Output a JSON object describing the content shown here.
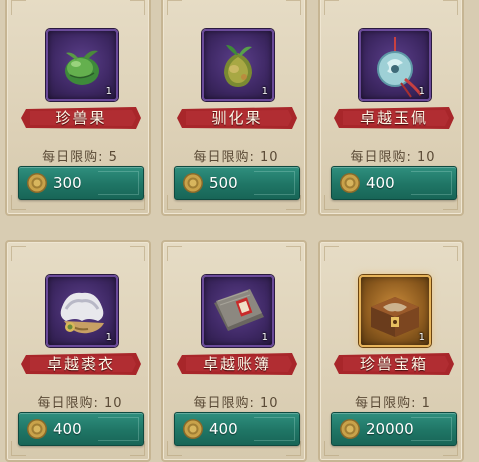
{
  "shop": {
    "items": [
      {
        "name": "珍兽果",
        "quantity": "1",
        "limit": "每日限购: 5",
        "price": "300",
        "icon": "green-fruit-icon",
        "frame": "purple"
      },
      {
        "name": "驯化果",
        "quantity": "1",
        "limit": "每日限购: 10",
        "price": "500",
        "icon": "sprout-fruit-icon",
        "frame": "purple"
      },
      {
        "name": "卓越玉佩",
        "quantity": "1",
        "limit": "每日限购: 10",
        "price": "400",
        "icon": "jade-pendant-icon",
        "frame": "purple"
      },
      {
        "name": "卓越裘衣",
        "quantity": "1",
        "limit": "每日限购: 10",
        "price": "400",
        "icon": "fur-coat-icon",
        "frame": "purple"
      },
      {
        "name": "卓越账簿",
        "quantity": "1",
        "limit": "每日限购: 10",
        "price": "400",
        "icon": "ledger-book-icon",
        "frame": "purple"
      },
      {
        "name": "珍兽宝箱",
        "quantity": "1",
        "limit": "每日限购: 1",
        "price": "20000",
        "icon": "treasure-chest-icon",
        "frame": "gold"
      }
    ]
  },
  "colors": {
    "ribbon_red": "#a8262a",
    "button_teal": "#1f7565",
    "coin_gold": "#c9a24a"
  }
}
